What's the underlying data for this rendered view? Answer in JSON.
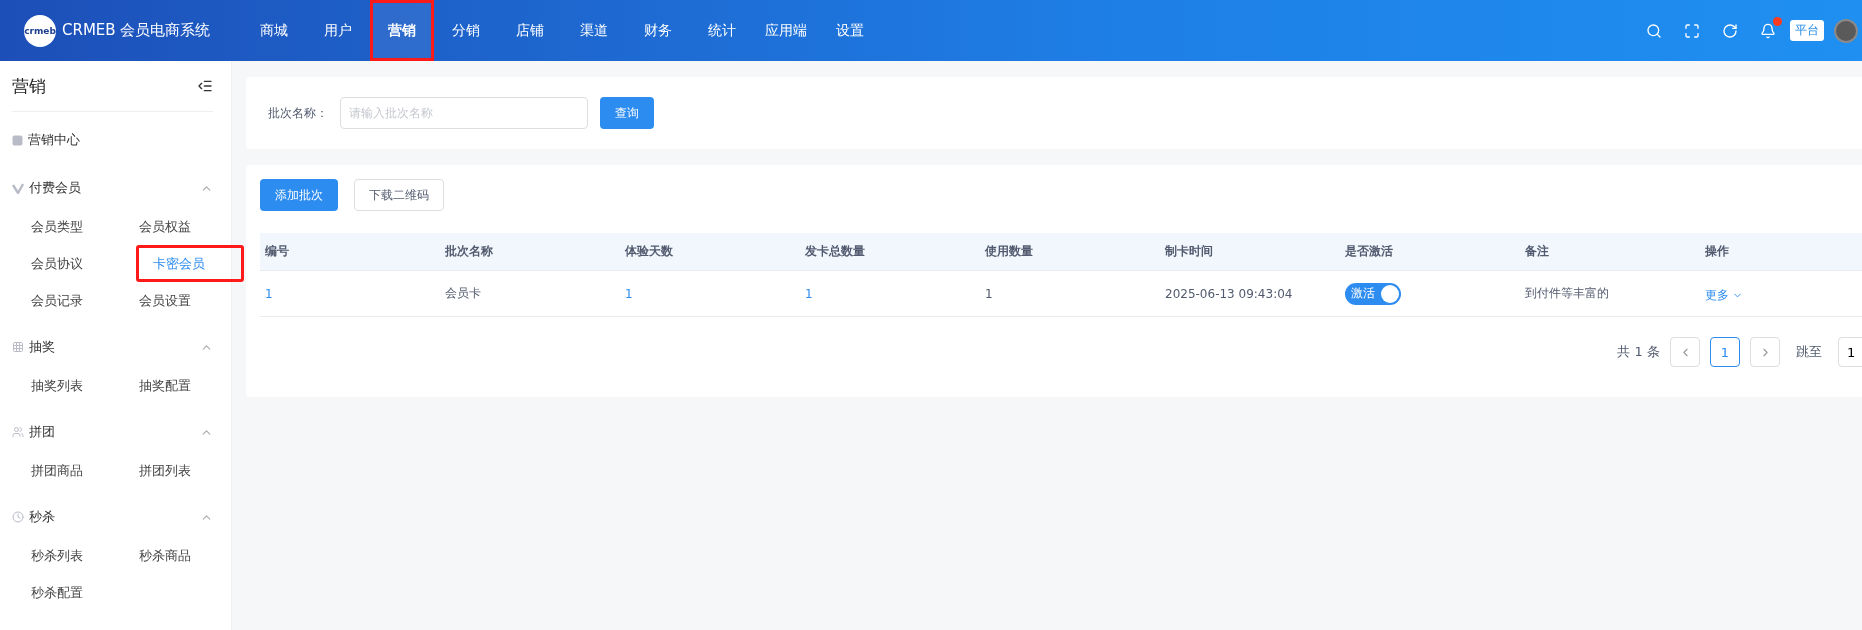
{
  "header": {
    "brand": "CRMEB 会员电商系统",
    "logo_text": "crmeb",
    "nav": [
      {
        "label": "商城",
        "selected": false,
        "highlighted": false
      },
      {
        "label": "用户",
        "selected": false,
        "highlighted": false
      },
      {
        "label": "营销",
        "selected": true,
        "highlighted": true
      },
      {
        "label": "分销",
        "selected": false,
        "highlighted": false
      },
      {
        "label": "店铺",
        "selected": false,
        "highlighted": false
      },
      {
        "label": "渠道",
        "selected": false,
        "highlighted": false
      },
      {
        "label": "财务",
        "selected": false,
        "highlighted": false
      },
      {
        "label": "统计",
        "selected": false,
        "highlighted": false
      },
      {
        "label": "应用端",
        "selected": false,
        "highlighted": false
      },
      {
        "label": "设置",
        "selected": false,
        "highlighted": false
      }
    ],
    "notification_dot": true,
    "platform_badge": "平台"
  },
  "sidebar": {
    "title": "营销",
    "items": [
      {
        "label": "营销中心",
        "kind": "link"
      },
      {
        "label": "付费会员",
        "kind": "group",
        "expanded": true,
        "children": [
          {
            "label": "会员类型",
            "selected": false,
            "highlighted": false
          },
          {
            "label": "会员权益",
            "selected": false,
            "highlighted": false
          },
          {
            "label": "会员协议",
            "selected": false,
            "highlighted": false
          },
          {
            "label": "卡密会员",
            "selected": true,
            "highlighted": true
          },
          {
            "label": "会员记录",
            "selected": false,
            "highlighted": false
          },
          {
            "label": "会员设置",
            "selected": false,
            "highlighted": false
          }
        ]
      },
      {
        "label": "抽奖",
        "kind": "group",
        "expanded": true,
        "children": [
          {
            "label": "抽奖列表",
            "selected": false,
            "highlighted": false
          },
          {
            "label": "抽奖配置",
            "selected": false,
            "highlighted": false
          }
        ]
      },
      {
        "label": "拼团",
        "kind": "group",
        "expanded": true,
        "children": [
          {
            "label": "拼团商品",
            "selected": false,
            "highlighted": false
          },
          {
            "label": "拼团列表",
            "selected": false,
            "highlighted": false
          }
        ]
      },
      {
        "label": "秒杀",
        "kind": "group",
        "expanded": true,
        "children": [
          {
            "label": "秒杀列表",
            "selected": false,
            "highlighted": false
          },
          {
            "label": "秒杀商品",
            "selected": false,
            "highlighted": false
          },
          {
            "label": "秒杀配置",
            "selected": false,
            "highlighted": false
          }
        ]
      }
    ]
  },
  "search": {
    "label": "批次名称：",
    "placeholder": "请输入批次名称",
    "button": "查询"
  },
  "toolbar": {
    "primary": "添加批次",
    "secondary": "下载二维码"
  },
  "table": {
    "columns": [
      "编号",
      "批次名称",
      "体验天数",
      "发卡总数量",
      "使用数量",
      "制卡时间",
      "是否激活",
      "备注",
      "操作"
    ],
    "rows": [
      {
        "id": "1",
        "name": "会员卡",
        "days": "1",
        "total": "1",
        "used": "1",
        "time": "2025-06-13 09:43:04",
        "active": {
          "label": "激活",
          "on": true
        },
        "note": "到付件等丰富的",
        "action": "更多"
      }
    ]
  },
  "pagination": {
    "total": "共 1 条",
    "pages": [
      {
        "label": "1",
        "selected": true
      }
    ],
    "jump_label": "跳至",
    "jump_value": "1"
  }
}
